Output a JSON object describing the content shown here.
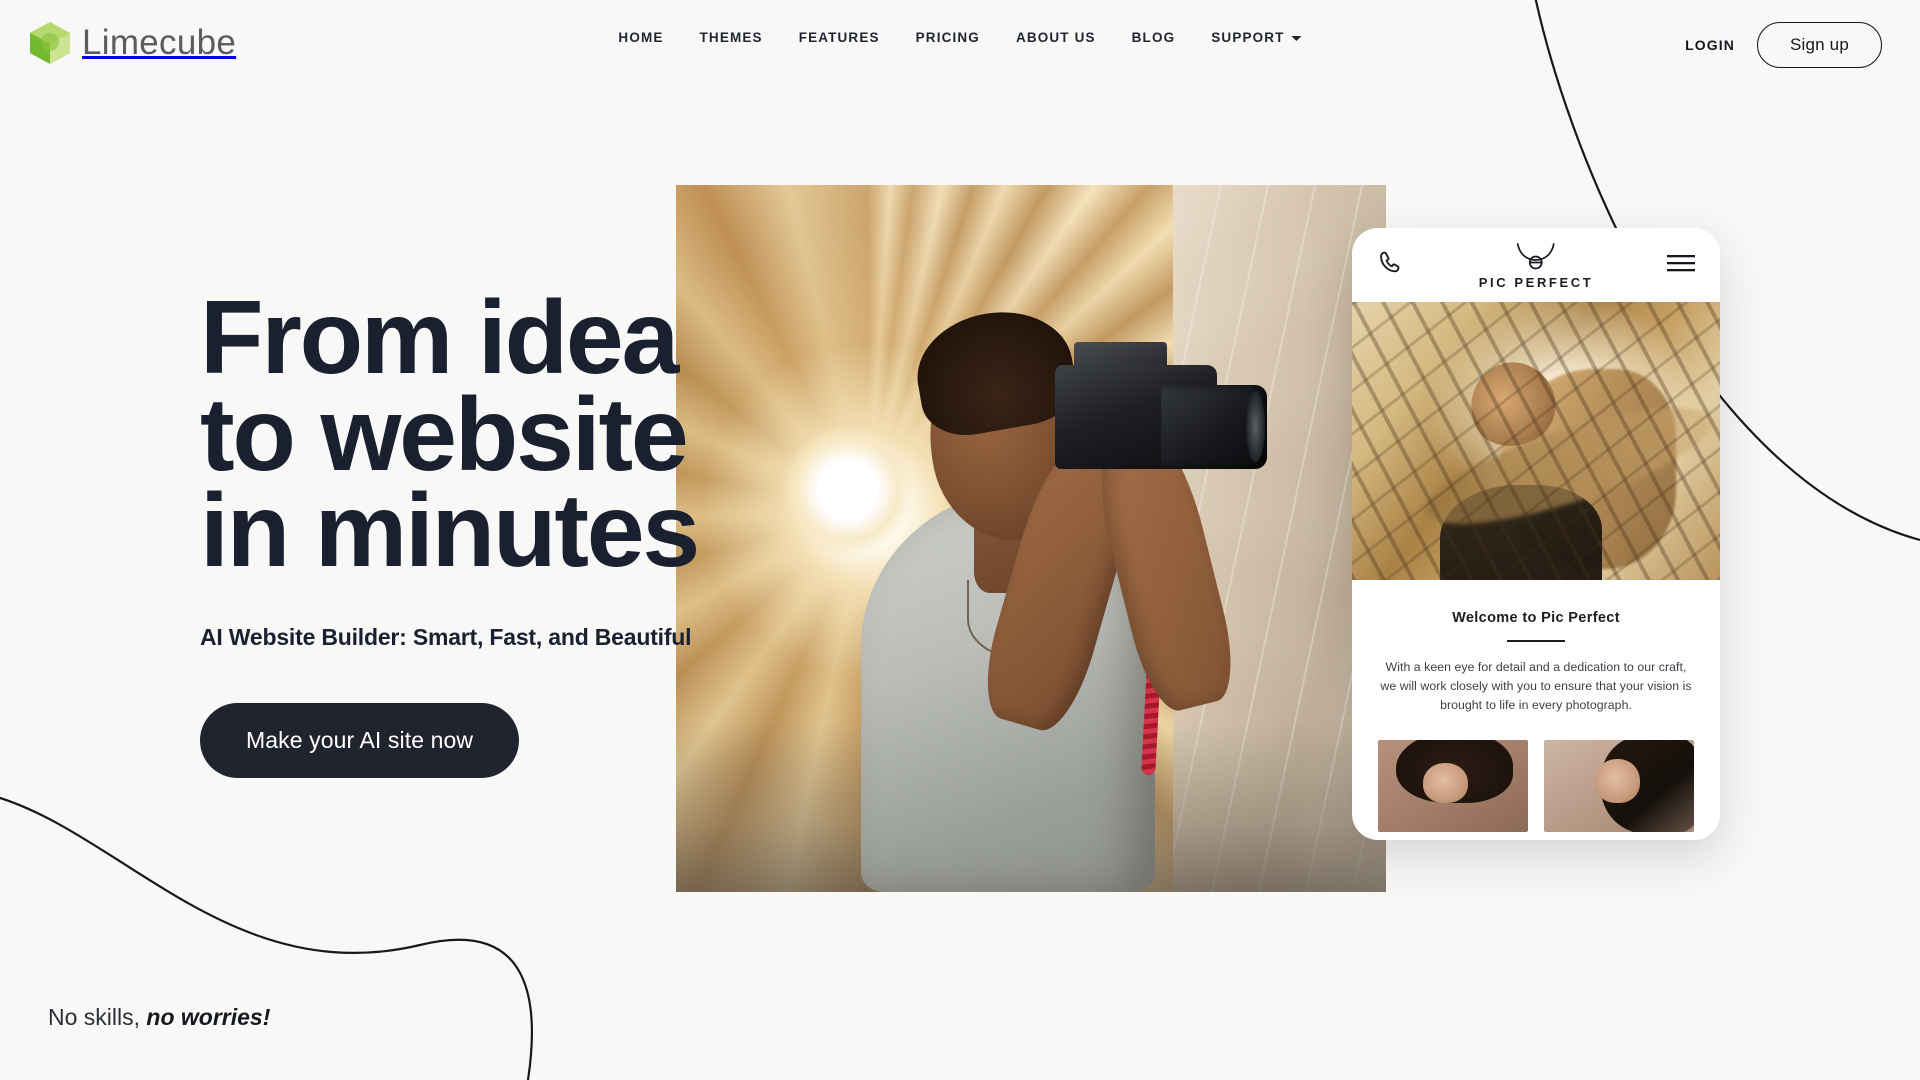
{
  "brand": {
    "name": "Limecube",
    "logo_icon": "green-cube-logo",
    "accent_green": "#8cc63e",
    "dark": "#21242e",
    "background": "#f8f8f7"
  },
  "nav": {
    "items": [
      {
        "label": "HOME",
        "has_dropdown": false
      },
      {
        "label": "THEMES",
        "has_dropdown": false
      },
      {
        "label": "FEATURES",
        "has_dropdown": false
      },
      {
        "label": "PRICING",
        "has_dropdown": false
      },
      {
        "label": "ABOUT US",
        "has_dropdown": false
      },
      {
        "label": "BLOG",
        "has_dropdown": false
      },
      {
        "label": "SUPPORT",
        "has_dropdown": true
      }
    ]
  },
  "auth": {
    "login_label": "LOGIN",
    "signup_label": "Sign up"
  },
  "hero": {
    "title_line1": "From idea",
    "title_line2": "to website",
    "title_line3": "in minutes",
    "subtitle": "AI Website Builder: Smart, Fast, and Beautiful",
    "cta_label": "Make your AI site now",
    "photo_alt": "photographer-with-camera"
  },
  "tagline": {
    "lead": "No skills,",
    "emphasis": "no worries!"
  },
  "phone_mockup": {
    "phone_icon": "phone-handset-icon",
    "logo_icon": "necklace-logo-icon",
    "brand_name": "PIC PERFECT",
    "menu_icon": "hamburger-menu-icon",
    "hero_image_alt": "woman-in-palm-shadow",
    "welcome_heading": "Welcome to Pic Perfect",
    "paragraph": "With a keen eye for detail and a dedication to our craft, we will work closely with you to ensure that your vision is brought to life in every photograph.",
    "gallery": [
      {
        "alt": "portrait-curly-hair"
      },
      {
        "alt": "portrait-long-hair"
      }
    ]
  },
  "decorations": {
    "curve_top_right": "decorative-curve-top-right",
    "curve_bottom_left": "decorative-curve-bottom-left"
  }
}
